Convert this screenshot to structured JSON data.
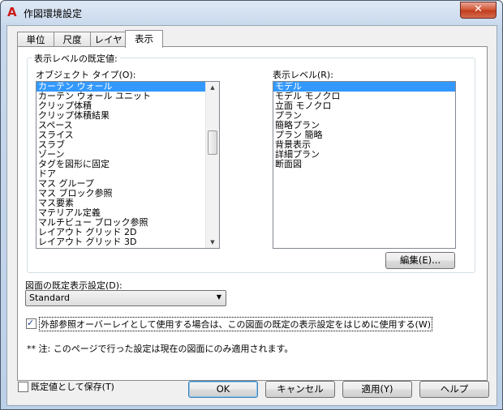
{
  "window": {
    "title": "作図環境設定",
    "close_glyph": "✕"
  },
  "tabs": [
    {
      "label": "単位"
    },
    {
      "label": "尺度"
    },
    {
      "label": "レイヤ"
    },
    {
      "label": "表示"
    }
  ],
  "group": {
    "legend": "表示レベルの既定値:",
    "object_type_label": "オブジェクト タイプ(O):",
    "display_level_label": "表示レベル(R):",
    "object_types": [
      "カーテン ウォール",
      "カーテン ウォール ユニット",
      "クリップ体積",
      "クリップ体積結果",
      "スペース",
      "スライス",
      "スラブ",
      "ゾーン",
      "タグを図形に固定",
      "ドア",
      "マス グループ",
      "マス ブロック参照",
      "マス要素",
      "マテリアル定義",
      "マルチビュー ブロック参照",
      "レイアウト グリッド 2D",
      "レイアウト グリッド 3D"
    ],
    "display_levels": [
      "モデル",
      "モデル モノクロ",
      "立面 モノクロ",
      "プラン",
      "簡略プラン",
      "プラン 簡略",
      "背景表示",
      "詳細プラン",
      "断面図"
    ],
    "edit_button": "編集(E)..."
  },
  "drawing_default": {
    "label": "図面の既定表示設定(D):",
    "value": "Standard"
  },
  "xref_checkbox": {
    "checked": true,
    "label": "外部参照オーバーレイとして使用する場合は、この図面の既定の表示設定をはじめに使用する(W)"
  },
  "note": "** 注: このページで行った設定は現在の図面にのみ適用されます。",
  "footer": {
    "save_default_label": "既定値として保存(T)",
    "save_default_checked": false,
    "ok": "OK",
    "cancel": "キャンセル",
    "apply": "適用(Y)",
    "help": "ヘルプ"
  },
  "icons": {
    "app": "autocad-a-icon",
    "scroll_up": "▲",
    "scroll_down": "▼",
    "combo_arrow": "▼",
    "checkmark": "✓"
  },
  "colors": {
    "selection": "#3399ff",
    "close_button": "#c0391b",
    "app_icon": "#cc1a1a"
  }
}
